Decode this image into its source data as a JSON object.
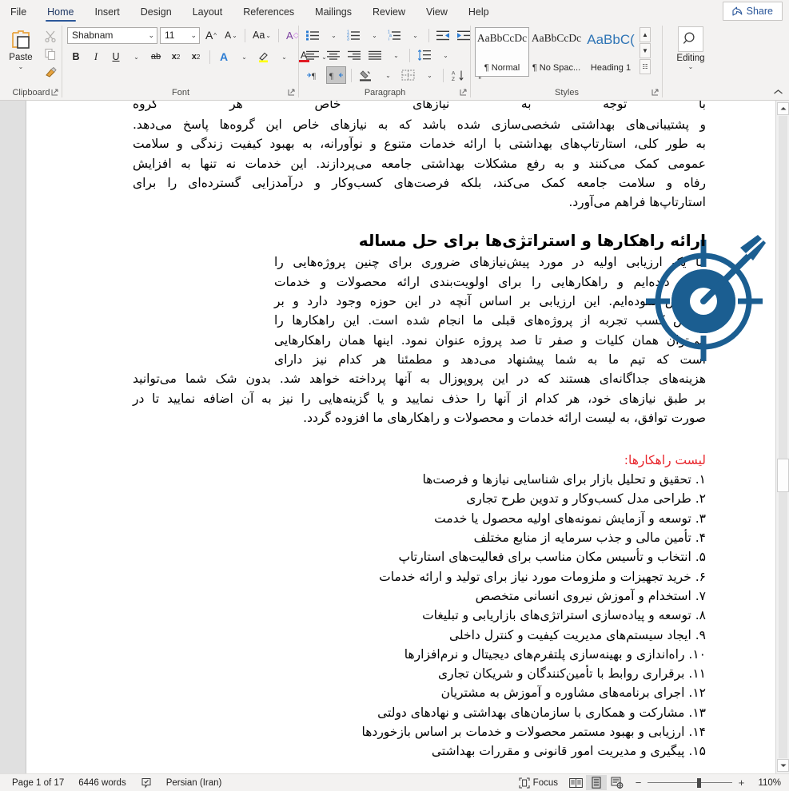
{
  "window": {
    "app": "Microsoft Word"
  },
  "tabs": [
    {
      "label": "File",
      "active": false
    },
    {
      "label": "Home",
      "active": true
    },
    {
      "label": "Insert",
      "active": false
    },
    {
      "label": "Design",
      "active": false
    },
    {
      "label": "Layout",
      "active": false
    },
    {
      "label": "References",
      "active": false
    },
    {
      "label": "Mailings",
      "active": false
    },
    {
      "label": "Review",
      "active": false
    },
    {
      "label": "View",
      "active": false
    },
    {
      "label": "Help",
      "active": false
    }
  ],
  "share": {
    "label": "Share",
    "icon": "share-icon"
  },
  "ribbon": {
    "clipboard": {
      "group_label": "Clipboard",
      "paste_label": "Paste",
      "dropdown_glyph": "⌄",
      "dialog_launcher": "⤵",
      "items": [
        {
          "name": "paste-button",
          "icon": "clipboard-icon"
        },
        {
          "name": "cut-button",
          "icon": "scissors-icon"
        },
        {
          "name": "copy-button",
          "icon": "copy-icon"
        },
        {
          "name": "format-painter-button",
          "icon": "paintbrush-icon"
        }
      ]
    },
    "font": {
      "group_label": "Font",
      "font_name": "Shabnam",
      "font_size": "11",
      "dialog_launcher": "⤵",
      "grow_font": "A",
      "shrink_font": "A",
      "change_case": "Aa",
      "clear_formatting": "A",
      "bold": "B",
      "italic": "I",
      "underline": "U",
      "strikethrough": "ab",
      "subscript": "x",
      "superscript": "x",
      "text_effects": "A",
      "highlight": "A",
      "font_color": "A",
      "sub_digit": "2",
      "sup_digit": "2",
      "colors": {
        "highlight": "#ffff00",
        "font_color": "#e01b24",
        "effects": "#2b7cd3"
      }
    },
    "paragraph": {
      "group_label": "Paragraph",
      "dialog_launcher": "⤵",
      "buttons": [
        {
          "name": "bullets-button"
        },
        {
          "name": "numbering-button"
        },
        {
          "name": "multilevel-list-button"
        },
        {
          "name": "decrease-indent-button"
        },
        {
          "name": "increase-indent-button"
        },
        {
          "name": "align-left-button"
        },
        {
          "name": "align-center-button"
        },
        {
          "name": "align-right-button"
        },
        {
          "name": "justify-button"
        },
        {
          "name": "line-spacing-button"
        },
        {
          "name": "ltr-text-direction-button"
        },
        {
          "name": "rtl-text-direction-button",
          "selected": true
        },
        {
          "name": "shading-button"
        },
        {
          "name": "borders-button"
        },
        {
          "name": "sort-button"
        },
        {
          "name": "show-formatting-marks-button"
        }
      ]
    },
    "styles": {
      "group_label": "Styles",
      "dialog_launcher": "⤵",
      "items": [
        {
          "preview": "AaBbCcDc",
          "name": "¶ Normal",
          "selected": true,
          "kind": "normal"
        },
        {
          "preview": "AaBbCcDc",
          "name": "¶ No Spac...",
          "selected": false,
          "kind": "normal"
        },
        {
          "preview": "AaBbC(",
          "name": "Heading 1",
          "selected": false,
          "kind": "heading"
        }
      ],
      "nav": [
        "▲",
        "▼",
        "☷"
      ]
    },
    "editing": {
      "group_label": "Editing",
      "label": "Editing",
      "icon": "search-icon",
      "dropdown_glyph": "⌄"
    },
    "collapse_glyph": "⌃"
  },
  "document": {
    "paragraph_top_clipped": "با توجه به نیازهای خاص هر گروه",
    "paragraph_1_lines": [
      "و پشتیبانی‌های بهداشتی شخصی‌سازی شده باشد که به نیازهای خاص این گروه‌ها پاسخ می‌دهد.",
      "به طور کلی، استارتاپ‌های بهداشتی با ارائه خدمات متنوع و نوآورانه، به بهبود کیفیت زندگی و سلامت",
      "عمومی کمک می‌کنند و به رفع مشکلات بهداشتی جامعه می‌پردازند. این خدمات نه تنها به افزایش",
      "رفاه و سلامت جامعه کمک می‌کند، بلکه فرصت‌های کسب‌وکار و درآمدزایی گسترده‌ای را برای",
      "استارتاپ‌ها فراهم می‌آورد."
    ],
    "heading": "ارائه راهکارها و استراتژی‌ها برای حل مساله",
    "paragraph_2_lines": [
      "ما یک ارزیابی اولیه در مورد پیش‌نیازهای ضروری برای چنین پروژه‌هایی را",
      "انجام داده‌ایم و راهکارهایی را برای اولویت‌بندی ارائه محصولات و خدمات",
      "مشخص نموده‌ایم. این ارزیابی بر اساس آنچه در این حوزه وجود دارد و بر",
      "اساس کسب تجربه از پروژه‌های قبلی ما انجام شده است. این راهکارها را",
      "می‌توان همان کلیات و صفر تا صد پروژه عنوان نمود. اینها همان راهکارهایی",
      "است که تیم ما به شما پیشنهاد می‌دهد و مطمئنا هر کدام نیز دارای",
      "هزینه‌های جداگانه‌ای هستند که در این پروپوزال به آنها پرداخته خواهد شد. بدون شک شما می‌توانید",
      "بر طبق نیازهای خود، هر کدام از آنها را حذف نمایید و یا گزینه‌هایی را نیز به آن اضافه نمایید تا در",
      "صورت توافق، به لیست ارائه خدمات و محصولات و راهکارهای ما افزوده گردد."
    ],
    "list_heading": "لیست راهکارها:",
    "list_heading_color": "#e8262d",
    "solutions": [
      {
        "num": "۱.",
        "text": "تحقیق و تحلیل بازار برای شناسایی نیازها و فرصت‌ها"
      },
      {
        "num": "۲.",
        "text": "طراحی مدل کسب‌وکار و تدوین طرح تجاری"
      },
      {
        "num": "۳.",
        "text": "توسعه و آزمایش نمونه‌های اولیه محصول یا خدمت"
      },
      {
        "num": "۴.",
        "text": "تأمین مالی و جذب سرمایه از منابع مختلف"
      },
      {
        "num": "۵.",
        "text": "انتخاب و تأسیس مکان مناسب برای فعالیت‌های استارتاپ"
      },
      {
        "num": "۶.",
        "text": "خرید تجهیزات و ملزومات مورد نیاز برای تولید و ارائه خدمات"
      },
      {
        "num": "۷.",
        "text": "استخدام و آموزش نیروی انسانی متخصص"
      },
      {
        "num": "۸.",
        "text": "توسعه و پیاده‌سازی استراتژی‌های بازاریابی و تبلیغات"
      },
      {
        "num": "۹.",
        "text": "ایجاد سیستم‌های مدیریت کیفیت و کنترل داخلی"
      },
      {
        "num": "۱۰.",
        "text": "راه‌اندازی و بهینه‌سازی پلتفرم‌های دیجیتال و نرم‌افزارها"
      },
      {
        "num": "۱۱.",
        "text": "برقراری روابط با تأمین‌کنندگان و شریکان تجاری"
      },
      {
        "num": "۱۲.",
        "text": "اجرای برنامه‌های مشاوره و آموزش به مشتریان"
      },
      {
        "num": "۱۳.",
        "text": "مشارکت و همکاری با سازمان‌های بهداشتی و نهادهای دولتی"
      },
      {
        "num": "۱۴.",
        "text": "ارزیابی و بهبود مستمر محصولات و خدمات بر اساس بازخوردها"
      },
      {
        "num": "۱۵.",
        "text": "پیگیری و مدیریت امور قانونی و مقررات بهداشتی"
      }
    ],
    "image": {
      "name": "target-dartboard-icon",
      "color": "#1b5e91"
    }
  },
  "statusbar": {
    "page": "Page 1 of 17",
    "words": "6446 words",
    "proofing_icon": "spellcheck-icon",
    "language": "Persian (Iran)",
    "focus_label": "Focus",
    "focus_icon": "focus-icon",
    "views": [
      {
        "name": "read-mode-view-button",
        "selected": false
      },
      {
        "name": "print-layout-view-button",
        "selected": true
      },
      {
        "name": "web-layout-view-button",
        "selected": false
      }
    ],
    "zoom_out": "−",
    "zoom_in": "+",
    "zoom_level": "110%"
  }
}
